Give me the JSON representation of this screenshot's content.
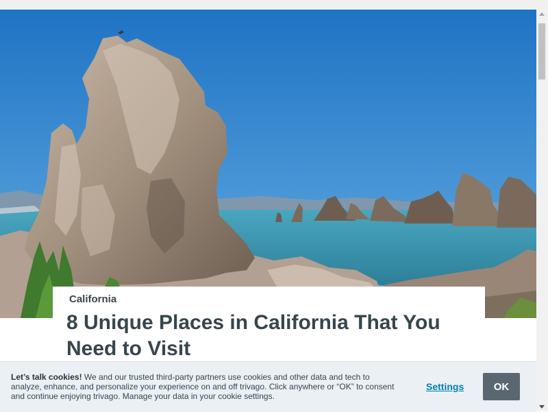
{
  "article": {
    "category": "California",
    "title": "8 Unique Places in California That You Need to Visit"
  },
  "hero_image": {
    "subject": "tufa rock towers rising from a lake under a clear blue sky"
  },
  "cookie_banner": {
    "heading": "Let’s talk cookies!",
    "body": " We and our trusted third-party partners use cookies and other data and tech to analyze, enhance, and personalize your experience on and off trivago. Click anywhere or “OK” to consent and continue enjoying trivago. Manage your data in your cookie settings.",
    "settings_label": "Settings",
    "ok_label": "OK"
  },
  "colors": {
    "text": "#37454d",
    "link": "#007faf",
    "button": "#5b6770",
    "banner_bg": "#ebf0f5",
    "sky": "#2e86d4",
    "lake": "#3a97ad"
  }
}
